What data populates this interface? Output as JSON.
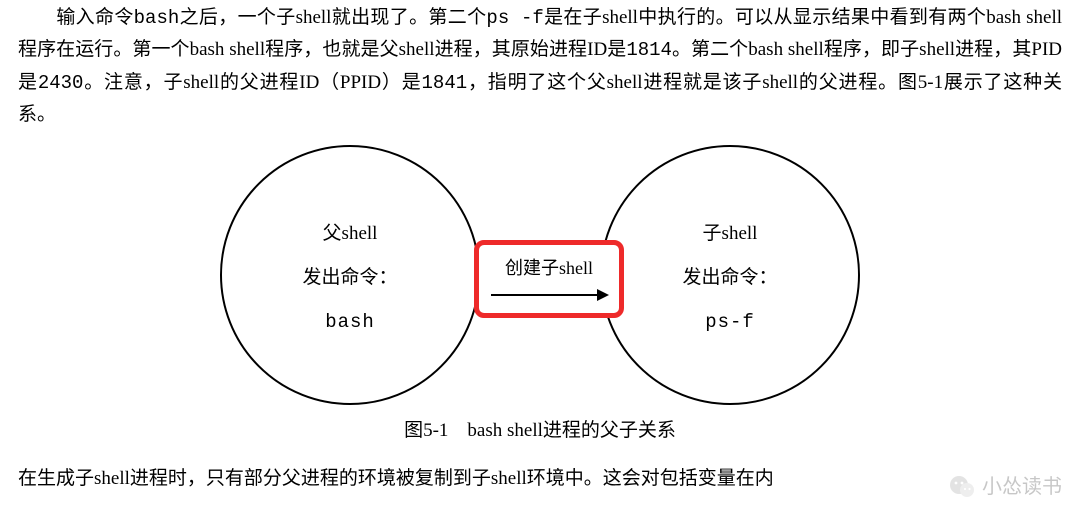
{
  "para1": {
    "t1": "输入命令",
    "t2": "bash",
    "t3": "之后，一个子shell就出现了。第二个",
    "t4": "ps -f",
    "t5": "是在子shell中执行的。可以从显示结果中看到有两个bash shell程序在运行。第一个bash shell程序，也就是父shell进程，其原始进程ID是",
    "t6": "1814",
    "t7": "。第二个bash shell程序，即子shell进程，其PID是",
    "t8": "2430",
    "t9": "。注意，子shell的父进程ID（PPID）是",
    "t10": "1841",
    "t11": "，指明了这个父shell进程就是该子shell的父进程。图5-1展示了这种关系。"
  },
  "diagram": {
    "left_title": "父shell",
    "left_sub": "发出命令：",
    "left_cmd": "bash",
    "mid_text": "创建子shell",
    "right_title": "子shell",
    "right_sub": "发出命令：",
    "right_cmd": "ps-f"
  },
  "caption": "图5-1　bash shell进程的父子关系",
  "para2": "在生成子shell进程时，只有部分父进程的环境被复制到子shell环境中。这会对包括变量在内",
  "watermark": "小怂读书"
}
